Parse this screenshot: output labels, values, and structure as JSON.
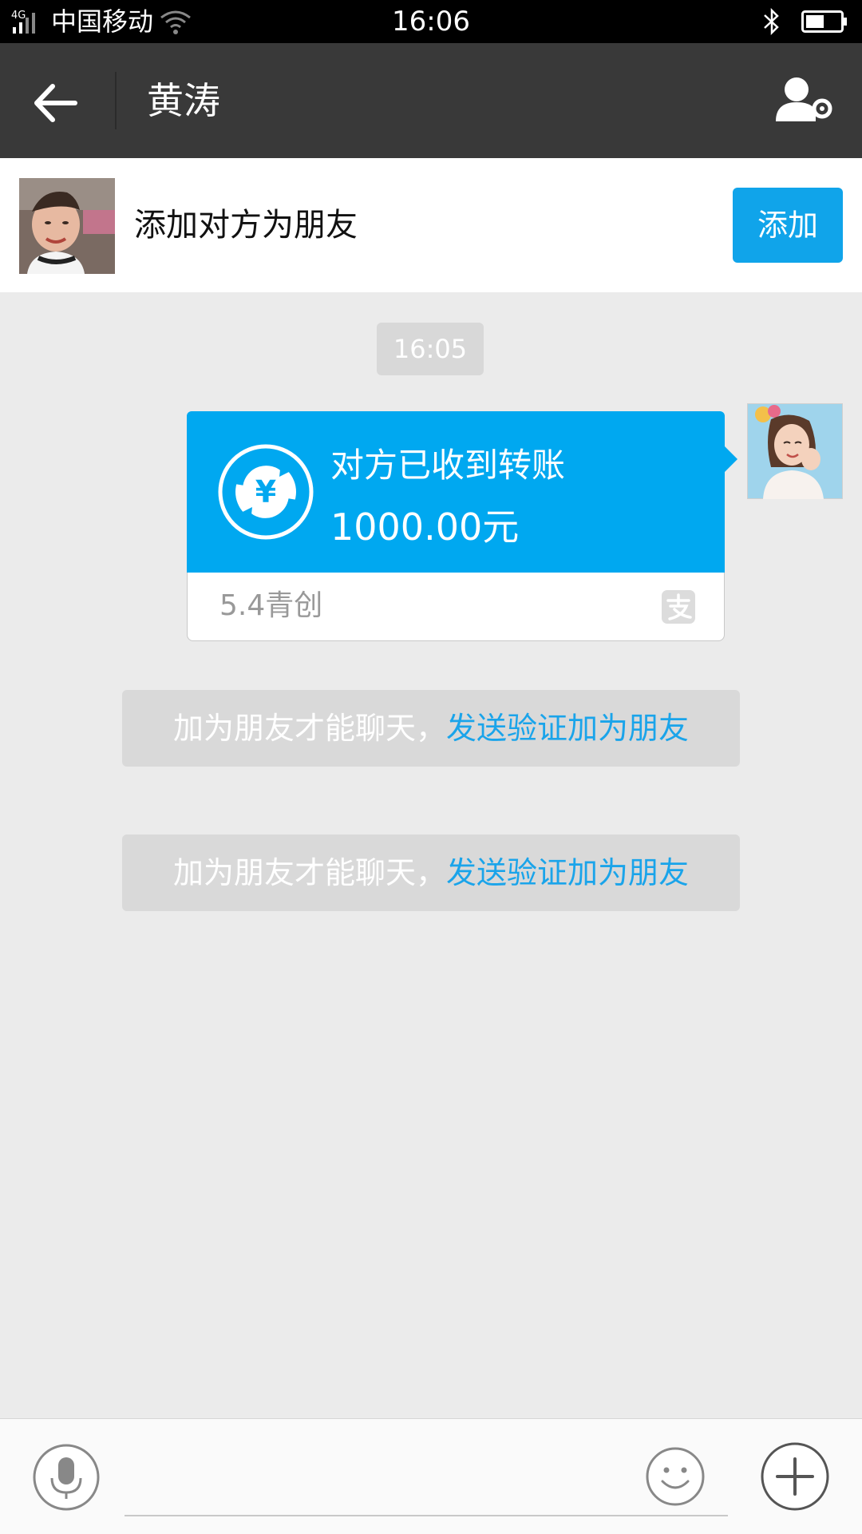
{
  "status_bar": {
    "network": "4G",
    "carrier": "中国移动",
    "time": "16:06",
    "icons": [
      "signal-icon",
      "wifi-icon",
      "bluetooth-icon",
      "battery-icon"
    ]
  },
  "title_bar": {
    "title": "黄涛",
    "icons": [
      "back-arrow-icon",
      "profile-settings-icon"
    ]
  },
  "add_friend_bar": {
    "text": "添加对方为朋友",
    "button_label": "添加"
  },
  "chat": {
    "timestamp": "16:05",
    "transfer_card": {
      "title": "对方已收到转账",
      "amount": "1000.00元",
      "note": "5.4青创",
      "icons": [
        "transfer-yuan-icon",
        "alipay-icon"
      ]
    },
    "notices": [
      {
        "text": "加为朋友才能聊天，",
        "link": "发送验证加为朋友"
      },
      {
        "text": "加为朋友才能聊天，",
        "link": "发送验证加为朋友"
      }
    ]
  },
  "input_bar": {
    "value": "",
    "icons": [
      "microphone-icon",
      "emoji-icon",
      "plus-icon"
    ]
  },
  "colors": {
    "accent": "#10a4ea",
    "title_bar": "#393939",
    "background": "#ebebeb"
  }
}
